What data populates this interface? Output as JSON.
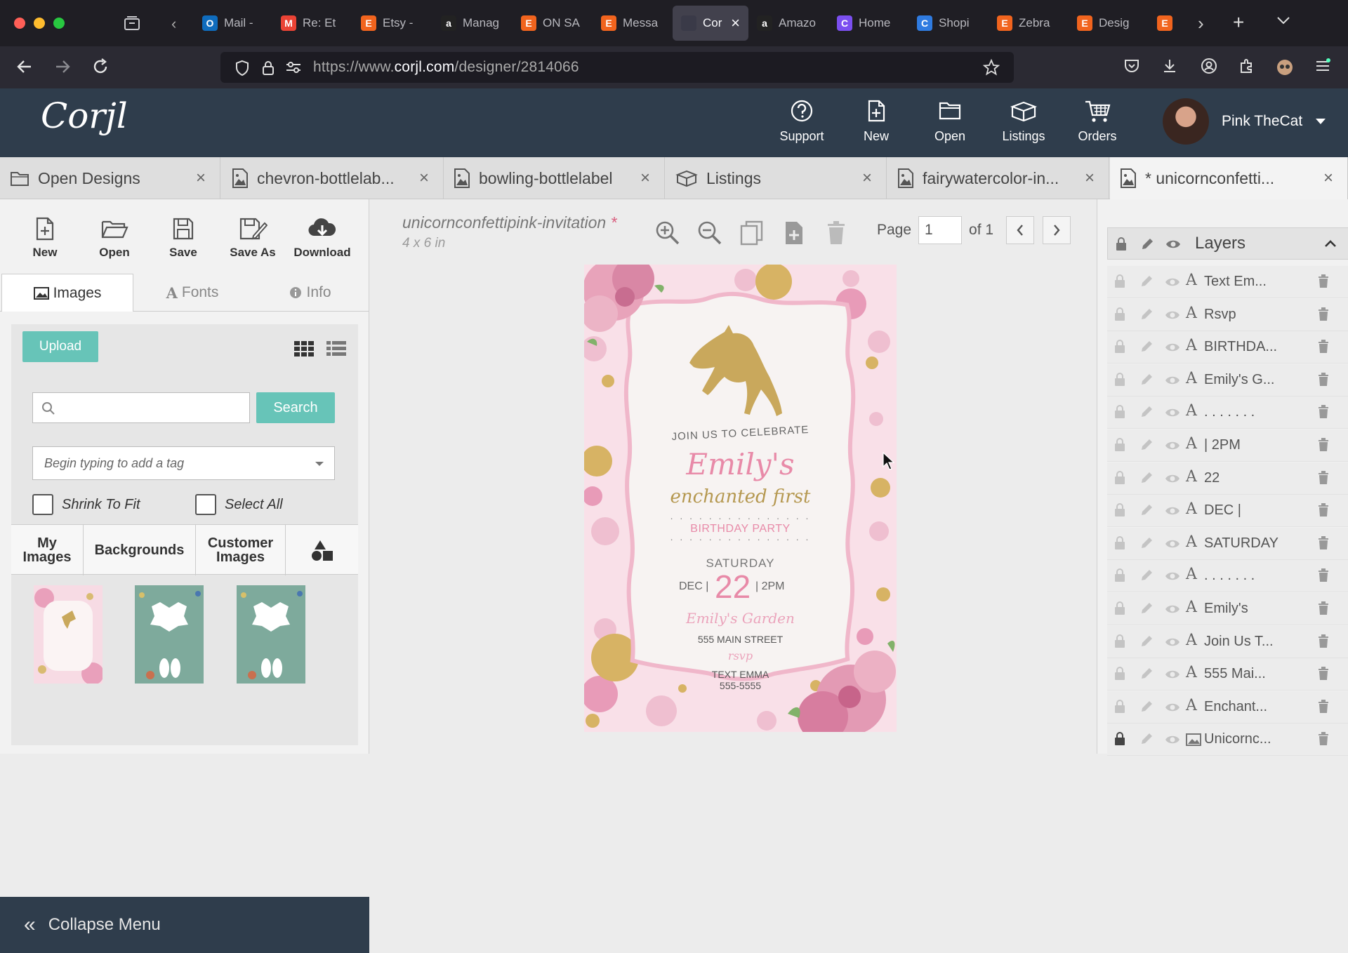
{
  "browser": {
    "tabs": [
      {
        "label": "Mail -",
        "icon": "outlook-icon",
        "color": "#0f6cbd",
        "glyph": "O"
      },
      {
        "label": "Re: Et",
        "icon": "gmail-icon",
        "color": "#ea4335",
        "glyph": "M"
      },
      {
        "label": "Etsy -",
        "icon": "etsy-icon",
        "color": "#f1641e",
        "glyph": "E"
      },
      {
        "label": "Manag",
        "icon": "amazon-icon",
        "color": "#222222",
        "glyph": "a"
      },
      {
        "label": "ON SA",
        "icon": "etsy-icon",
        "color": "#f1641e",
        "glyph": "E"
      },
      {
        "label": "Messa",
        "icon": "etsy-icon",
        "color": "#f1641e",
        "glyph": "E"
      },
      {
        "label": "Cor",
        "icon": "corjl-icon",
        "color": "#3a3a48",
        "glyph": "",
        "active": true
      },
      {
        "label": "Amazo",
        "icon": "amazon-icon",
        "color": "#222222",
        "glyph": "a"
      },
      {
        "label": "Home",
        "icon": "canva-icon",
        "color": "#7b4ff0",
        "glyph": "C"
      },
      {
        "label": "Shopi",
        "icon": "canva-icon",
        "color": "#2f7be0",
        "glyph": "C"
      },
      {
        "label": "Zebra",
        "icon": "etsy-icon",
        "color": "#f1641e",
        "glyph": "E"
      },
      {
        "label": "Desig",
        "icon": "etsy-icon",
        "color": "#f1641e",
        "glyph": "E"
      },
      {
        "label": "",
        "icon": "etsy-icon",
        "color": "#f1641e",
        "glyph": "E"
      }
    ],
    "url_prefix": "https://www.",
    "url_domain": "corjl.com",
    "url_path": "/designer/2814066"
  },
  "app": {
    "logo": "Corjl",
    "nav": [
      {
        "label": "Support",
        "icon": "help-circle-icon"
      },
      {
        "label": "New",
        "icon": "new-file-icon"
      },
      {
        "label": "Open",
        "icon": "folder-icon"
      },
      {
        "label": "Listings",
        "icon": "box-icon"
      },
      {
        "label": "Orders",
        "icon": "cart-icon"
      }
    ],
    "user_name": "Pink TheCat"
  },
  "doc_tabs": [
    {
      "label": "Open Designs",
      "icon": "folder-icon"
    },
    {
      "label": "chevron-bottlelab...",
      "icon": "image-file-icon"
    },
    {
      "label": "bowling-bottlelabel",
      "icon": "image-file-icon"
    },
    {
      "label": "Listings",
      "icon": "box-icon"
    },
    {
      "label": "fairywatercolor-in...",
      "icon": "image-file-icon"
    },
    {
      "label": "* unicornconfetti...",
      "icon": "image-file-icon",
      "active": true
    }
  ],
  "toolbar": {
    "new": "New",
    "open": "Open",
    "save": "Save",
    "save_as": "Save As",
    "download": "Download"
  },
  "panel": {
    "tabs": {
      "images": "Images",
      "fonts": "Fonts",
      "info": "Info"
    },
    "upload": "Upload",
    "search_button": "Search",
    "tag_placeholder": "Begin typing to add a tag",
    "shrink_to_fit": "Shrink To Fit",
    "select_all": "Select All",
    "categories": {
      "my_images": "My Images",
      "backgrounds": "Backgrounds",
      "customer_images": "Customer Images"
    },
    "collapse": "Collapse Menu"
  },
  "canvas": {
    "doc_title": "unicornconfettipink-invitation",
    "dirty_marker": "*",
    "doc_size": "4 x 6 in",
    "page_label": "Page",
    "page_value": "1",
    "page_of": "of 1"
  },
  "card": {
    "join": "JOIN US TO CELEBRATE",
    "name": "Emily's",
    "enchanted": "enchanted first",
    "dots": ". . . . . . . . . . . . . . .",
    "birthday": "BIRTHDAY PARTY",
    "day": "SATURDAY",
    "dec": "DEC |",
    "date": "22",
    "time": "| 2PM",
    "venue": "Emily's Garden",
    "address": "555 MAIN STREET",
    "rsvp": "rsvp",
    "text_emma": "TEXT EMMA",
    "phone": "555-5555",
    "colors": {
      "pink": "#e88aa8",
      "gold": "#c9a85c",
      "panel": "#f7f3f2"
    }
  },
  "layers": {
    "title": "Layers",
    "items": [
      {
        "name": "Text Em...",
        "type": "text",
        "locked": false
      },
      {
        "name": "Rsvp",
        "type": "text",
        "locked": false
      },
      {
        "name": "BIRTHDA...",
        "type": "text",
        "locked": false
      },
      {
        "name": "Emily's G...",
        "type": "text",
        "locked": false
      },
      {
        "name": ". . . . . . .",
        "type": "text",
        "locked": false
      },
      {
        "name": "| 2PM",
        "type": "text",
        "locked": false
      },
      {
        "name": "22",
        "type": "text",
        "locked": false
      },
      {
        "name": "DEC |",
        "type": "text",
        "locked": false
      },
      {
        "name": "SATURDAY",
        "type": "text",
        "locked": false
      },
      {
        "name": ". . . . . . .",
        "type": "text",
        "locked": false
      },
      {
        "name": "Emily's",
        "type": "text",
        "locked": false
      },
      {
        "name": "Join Us T...",
        "type": "text",
        "locked": false
      },
      {
        "name": "555 Mai...",
        "type": "text",
        "locked": false
      },
      {
        "name": "Enchant...",
        "type": "text",
        "locked": false
      },
      {
        "name": "Unicornc...",
        "type": "image",
        "locked": true
      }
    ]
  }
}
